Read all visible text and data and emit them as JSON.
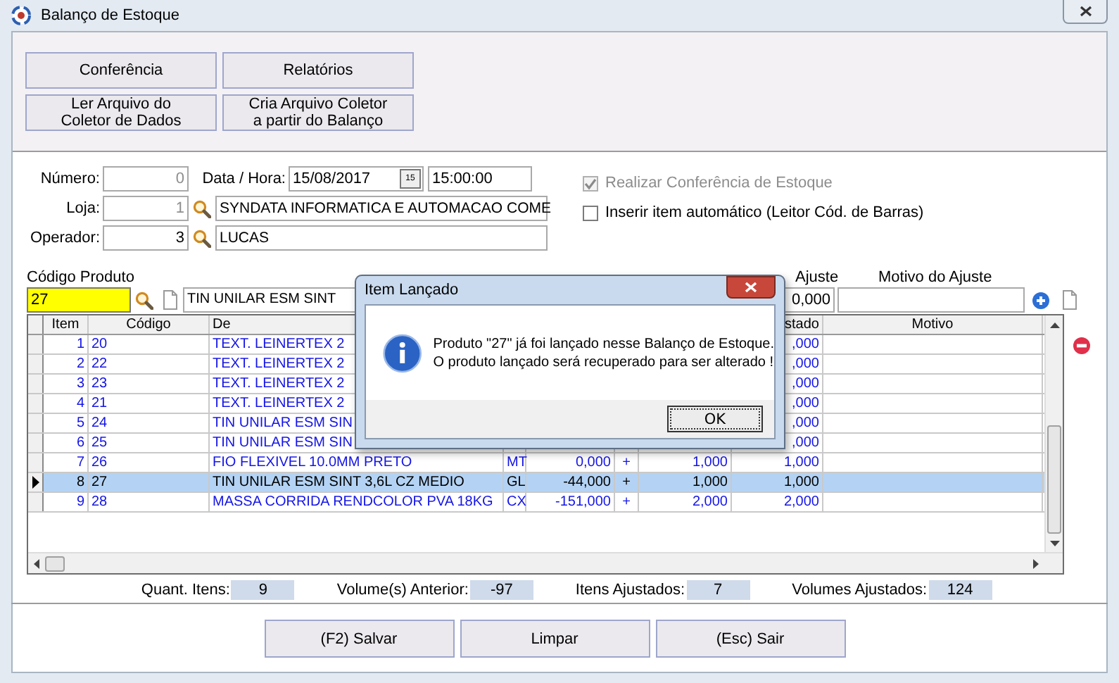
{
  "window": {
    "title": "Balanço de Estoque"
  },
  "toolbar_buttons": [
    "Conferência",
    "Relatórios",
    "Ler Arquivo do\nColetor de Dados",
    "Cria Arquivo Coletor\na partir do Balanço"
  ],
  "form": {
    "number": {
      "label": "Número:",
      "value": "0",
      "disabled": true
    },
    "date_time": {
      "label": "Data / Hora:",
      "date": "15/08/2017",
      "calendar": "15",
      "time": "15:00:00"
    },
    "store": {
      "label": "Loja:",
      "code": "1",
      "disabled": true,
      "name": "SYNDATA INFORMATICA E AUTOMACAO COME"
    },
    "operator": {
      "label": "Operador:",
      "code": "3",
      "disabled": false,
      "name": "LUCAS"
    }
  },
  "options": [
    {
      "label": "Realizar Conferência de Estoque",
      "checked": true,
      "disabled": true
    },
    {
      "label": "Inserir item automático (Leitor Cód. de Barras)",
      "checked": false,
      "disabled": false
    }
  ],
  "entry": {
    "code_label": "Código Produto",
    "code": "27",
    "description": "TIN UNILAR ESM SINT",
    "qty_label": "Ajuste",
    "qty": "0,000",
    "reason_label": "Motivo do Ajuste"
  },
  "table": {
    "columns": {
      "item": "Item",
      "code": "Código",
      "description": "De",
      "adjusted": "stado",
      "reason": "Motivo"
    },
    "rows": [
      {
        "item": "1",
        "code": "20",
        "description": "TEXT. LEINERTEX 2",
        "adjusted": ",000",
        "selected": false
      },
      {
        "item": "2",
        "code": "22",
        "description": "TEXT. LEINERTEX 2",
        "adjusted": ",000",
        "selected": false
      },
      {
        "item": "3",
        "code": "23",
        "description": "TEXT. LEINERTEX 2",
        "adjusted": ",000",
        "selected": false
      },
      {
        "item": "4",
        "code": "21",
        "description": "TEXT. LEINERTEX 2",
        "adjusted": ",000",
        "selected": false
      },
      {
        "item": "5",
        "code": "24",
        "description": "TIN UNILAR ESM SIN",
        "adjusted": ",000",
        "selected": false
      },
      {
        "item": "6",
        "code": "25",
        "description": "TIN UNILAR ESM SIN",
        "adjusted": ",000",
        "selected": false
      },
      {
        "item": "7",
        "code": "26",
        "description": "FIO FLEXIVEL 10.0MM PRETO",
        "unit": "MT",
        "stock": "0,000",
        "sign": "+",
        "qty": "1,000",
        "adjusted": "1,000",
        "selected": false
      },
      {
        "item": "8",
        "code": "27",
        "description": "TIN UNILAR ESM SINT 3,6L CZ MEDIO",
        "unit": "GL",
        "stock": "-44,000",
        "sign": "+",
        "qty": "1,000",
        "adjusted": "1,000",
        "selected": true
      },
      {
        "item": "9",
        "code": "28",
        "description": "MASSA CORRIDA RENDCOLOR PVA 18KG",
        "unit": "CX",
        "stock": "-151,000",
        "sign": "+",
        "qty": "2,000",
        "adjusted": "2,000",
        "selected": false
      }
    ]
  },
  "summary": [
    {
      "label": "Quant. Itens:",
      "value": "9"
    },
    {
      "label": "Volume(s) Anterior:",
      "value": "-97"
    },
    {
      "label": "Itens Ajustados:",
      "value": "7"
    },
    {
      "label": "Volumes Ajustados:",
      "value": "124"
    }
  ],
  "buttons": [
    "(F2) Salvar",
    "Limpar",
    "(Esc) Sair"
  ],
  "dialog": {
    "title": "Item Lançado",
    "message": "Produto \"27\" já foi lançado nesse Balanço de Estoque.\nO produto lançado será recuperado para ser alterado !",
    "button": "OK"
  }
}
